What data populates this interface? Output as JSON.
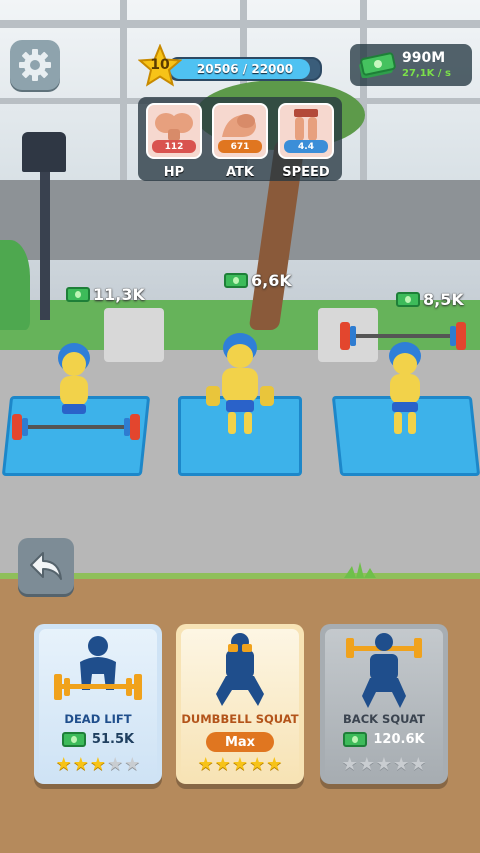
{
  "hud": {
    "level": "10",
    "xp_text": "20506 / 22000",
    "xp_fraction": 0.932,
    "money": "990M",
    "money_rate": "27,1K / s"
  },
  "stats": [
    {
      "label": "HP",
      "value": "112",
      "icon": "chest-muscle-icon"
    },
    {
      "label": "ATK",
      "value": "671",
      "icon": "flexed-arm-icon"
    },
    {
      "label": "SPEED",
      "value": "4.4",
      "icon": "legs-icon"
    }
  ],
  "stations": [
    {
      "earning": "11,3K"
    },
    {
      "earning": "6,6K"
    },
    {
      "earning": "8,5K"
    }
  ],
  "exercises": [
    {
      "name": "DEAD LIFT",
      "price": "51.5K",
      "stars": 3,
      "max": false,
      "theme": "blue"
    },
    {
      "name": "DUMBBELL SQUAT",
      "max_label": "Max",
      "stars": 5,
      "max": true,
      "theme": "yellow"
    },
    {
      "name": "BACK SQUAT",
      "price": "120.6K",
      "stars": 0,
      "max": false,
      "theme": "gray"
    }
  ],
  "colors": {
    "accent_orange": "#e07620",
    "money_green": "#7be04a",
    "mat_blue": "#3db2ea",
    "star_gold": "#f7c318"
  },
  "icons": [
    "gear-icon",
    "back-arrow-icon",
    "cash-icon",
    "level-star-icon"
  ]
}
